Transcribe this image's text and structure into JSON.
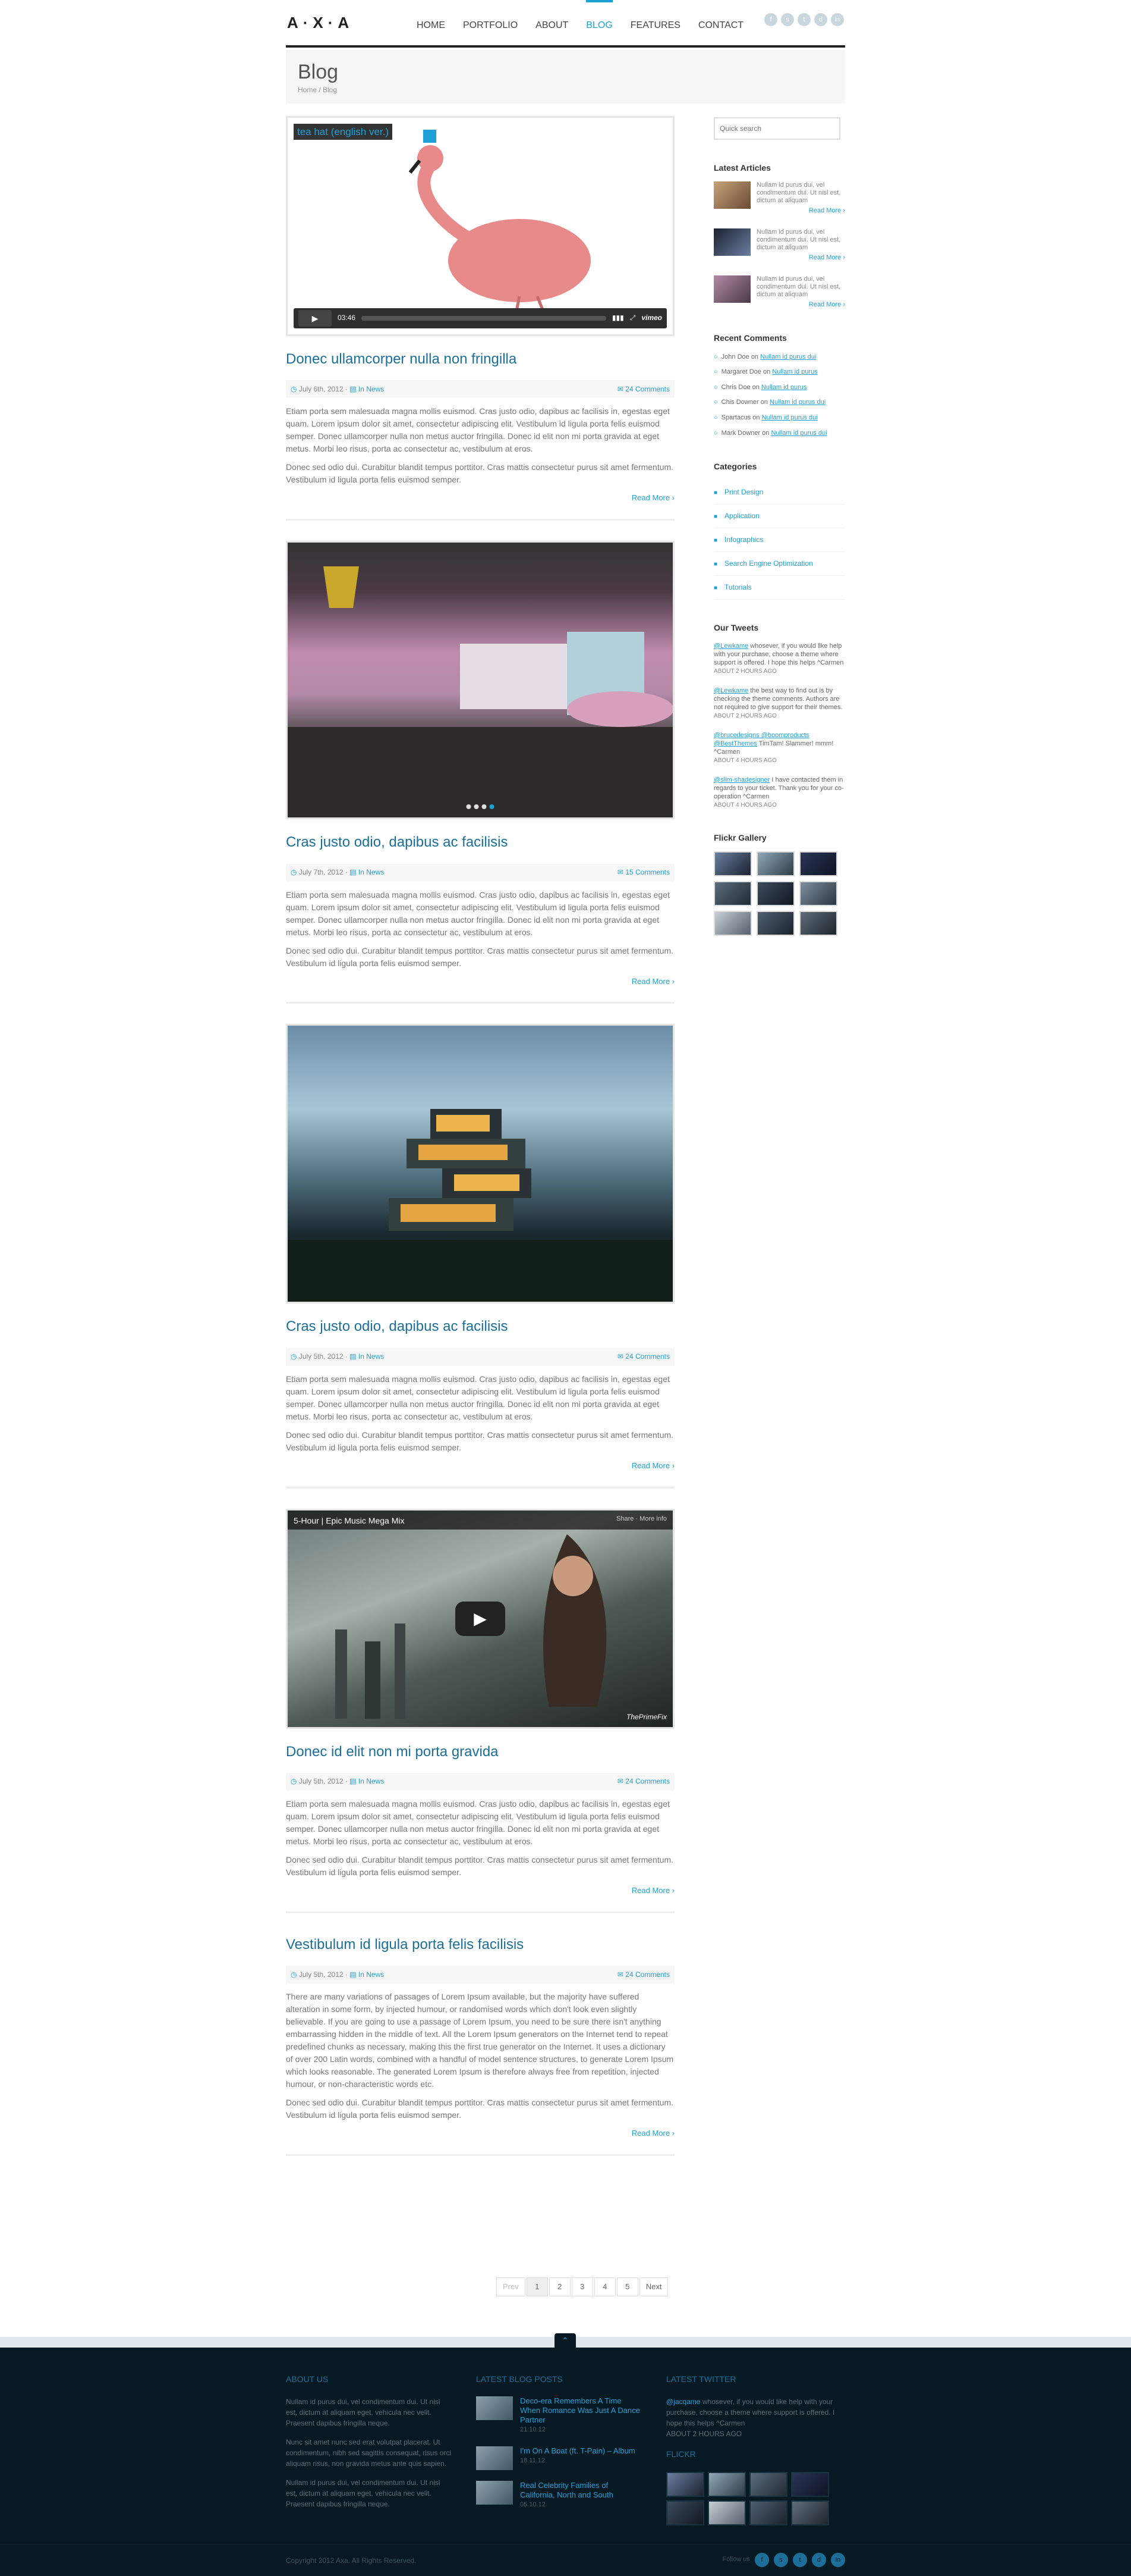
{
  "header": {
    "logo": "A·X·A",
    "nav": [
      "HOME",
      "PORTFOLIO",
      "ABOUT",
      "BLOG",
      "FEATURES",
      "CONTACT"
    ],
    "active_nav": "BLOG",
    "social": [
      "f",
      "s",
      "t",
      "d",
      "in"
    ]
  },
  "title_band": {
    "title": "Blog",
    "breadcrumb": "Home / Blog"
  },
  "posts": [
    {
      "media": {
        "type": "vimeo",
        "title": "tea hat (english ver.)",
        "time": "03:46",
        "brand": "vimeo"
      },
      "title": "Donec ullamcorper nulla non fringilla",
      "date": "July 6th, 2012",
      "category": "In News",
      "comments": "24 Comments",
      "paragraphs": [
        "Etiam porta sem malesuada magna mollis euismod. Cras justo odio, dapibus ac facilisis in, egestas eget quam. Lorem ipsum dolor sit amet, consectetur adipiscing elit. Vestibulum id ligula porta felis euismod semper. Donec ullamcorper nulla non metus auctor fringilla. Donec id elit non mi porta gravida at eget metus. Morbi leo risus, porta ac consectetur ac, vestibulum at eros.",
        "Donec sed odio dui. Curabitur blandit tempus porttitor. Cras mattis consectetur purus sit amet fermentum. Vestibulum id ligula porta felis euismod semper."
      ],
      "read_more": "Read More ›"
    },
    {
      "media": {
        "type": "slider"
      },
      "title": "Cras justo odio, dapibus ac facilisis",
      "date": "July 7th, 2012",
      "category": "In News",
      "comments": "15 Comments",
      "paragraphs": [
        "Etiam porta sem malesuada magna mollis euismod. Cras justo odio, dapibus ac facilisis in, egestas eget quam. Lorem ipsum dolor sit amet, consectetur adipiscing elit. Vestibulum id ligula porta felis euismod semper. Donec ullamcorper nulla non metus auctor fringilla. Donec id elit non mi porta gravida at eget metus. Morbi leo risus, porta ac consectetur ac, vestibulum at eros.",
        "Donec sed odio dui. Curabitur blandit tempus porttitor. Cras mattis consectetur purus sit amet fermentum. Vestibulum id ligula porta felis euismod semper."
      ],
      "read_more": "Read More ›"
    },
    {
      "media": {
        "type": "image"
      },
      "title": "Cras justo odio, dapibus ac facilisis",
      "date": "July 5th, 2012",
      "category": "In News",
      "comments": "24 Comments",
      "paragraphs": [
        "Etiam porta sem malesuada magna mollis euismod. Cras justo odio, dapibus ac facilisis in, egestas eget quam. Lorem ipsum dolor sit amet, consectetur adipiscing elit. Vestibulum id ligula porta felis euismod semper. Donec ullamcorper nulla non metus auctor fringilla. Donec id elit non mi porta gravida at eget metus. Morbi leo risus, porta ac consectetur ac, vestibulum at eros.",
        "Donec sed odio dui. Curabitur blandit tempus porttitor. Cras mattis consectetur purus sit amet fermentum. Vestibulum id ligula porta felis euismod semper."
      ],
      "read_more": "Read More ›"
    },
    {
      "media": {
        "type": "youtube",
        "title": "5-Hour | Epic Music Mega Mix",
        "actions": "Share  ·  More info",
        "brand": "ThePrimeFix"
      },
      "title": "Donec id elit non mi porta gravida",
      "date": "July 5th, 2012",
      "category": "In News",
      "comments": "24 Comments",
      "paragraphs": [
        "Etiam porta sem malesuada magna mollis euismod. Cras justo odio, dapibus ac facilisis in, egestas eget quam. Lorem ipsum dolor sit amet, consectetur adipiscing elit. Vestibulum id ligula porta felis euismod semper. Donec ullamcorper nulla non metus auctor fringilla. Donec id elit non mi porta gravida at eget metus. Morbi leo risus, porta ac consectetur ac, vestibulum at eros.",
        "Donec sed odio dui. Curabitur blandit tempus porttitor. Cras mattis consectetur purus sit amet fermentum. Vestibulum id ligula porta felis euismod semper."
      ],
      "read_more": "Read More ›"
    },
    {
      "media": {
        "type": "none"
      },
      "title": "Vestibulum id ligula porta felis facilisis",
      "date": "July 5th, 2012",
      "category": "In News",
      "comments": "24 Comments",
      "paragraphs": [
        "There are many variations of passages of Lorem Ipsum available, but the majority have suffered alteration in some form, by injected humour, or randomised words which don't look even slightly believable. If you are going to use a passage of Lorem Ipsum, you need to be sure there isn't anything embarrassing hidden in the middle of text. All the Lorem Ipsum generators on the Internet tend to repeat predefined chunks as necessary, making this the first true generator on the Internet. It uses a dictionary of over 200 Latin words, combined with a handful of model sentence structures, to generate Lorem Ipsum which looks reasonable. The generated Lorem Ipsum is therefore always free from repetition, injected humour, or non-characteristic words etc.",
        "Donec sed odio dui. Curabitur blandit tempus porttitor. Cras mattis consectetur purus sit amet fermentum. Vestibulum id ligula porta felis euismod semper."
      ],
      "read_more": "Read More ›"
    }
  ],
  "pagination": [
    "Prev",
    "1",
    "2",
    "3",
    "4",
    "5",
    "Next"
  ],
  "sidebar": {
    "search_placeholder": "Quick search",
    "latest_title": "Latest Articles",
    "latest": [
      {
        "text": "Nullam id purus dui, vel condimentum dui. Ut nisl est, dictum at aliquam",
        "more": "Read More ›"
      },
      {
        "text": "Nullam id purus dui, vel condimentum dui. Ut nisl est, dictum at aliquam",
        "more": "Read More ›"
      },
      {
        "text": "Nullam id purus dui, vel condimentum dui. Ut nisl est, dictum at aliquam",
        "more": "Read More ›"
      }
    ],
    "comments_title": "Recent Comments",
    "comments": [
      {
        "author": "John Doe",
        "on": "on",
        "link": "Nullam id purus dui"
      },
      {
        "author": "Margaret Doe",
        "on": "on",
        "link": "Nullam id purus"
      },
      {
        "author": "Chris Doe",
        "on": "on",
        "link": "Nullam id purus"
      },
      {
        "author": "Chis Downer",
        "on": "on",
        "link": "Nullam id purus dui"
      },
      {
        "author": "Spartacus",
        "on": "on",
        "link": "Nullam id purus dui"
      },
      {
        "author": "Mark Downer",
        "on": "on",
        "link": "Nullam id purus dui"
      }
    ],
    "categories_title": "Categories",
    "categories": [
      "Print Design",
      "Application",
      "Infographics",
      "Search Engine Optimization",
      "Tutorials"
    ],
    "tweets_title": "Our Tweets",
    "tweets": [
      {
        "handle": "@Lewkame",
        "text": " whosever, if you would like help with your purchase, choose a theme where support is offered. I hope this helps ^Carmen",
        "ago": "ABOUT 2 HOURS AGO"
      },
      {
        "handle": "@Lewkame",
        "text": " the best way to find out is by checking the theme comments. Authors are not required to give support for their themes.",
        "ago": "ABOUT 2 HOURS AGO"
      },
      {
        "handle": "@brucedesigns @boomproducts @BestThemes",
        "text": " TimTam! Slammer! mmm! ^Carmen",
        "ago": "ABOUT 4 HOURS AGO"
      },
      {
        "handle": "@slim-shadesigner",
        "text": " I have contacted them in regards to your ticket. Thank you for your co-operation ^Carmen",
        "ago": "ABOUT 4 HOURS AGO"
      }
    ],
    "flickr_title": "Flickr Gallery"
  },
  "footer": {
    "about_title": "About Us",
    "about_paragraphs": [
      "Nullam id purus dui, vel condimentum dui. Ut nisl est, dictum at aliquam eget, vehicula nec velit. Praesent dapibus fringilla neque.",
      "Nunc sit amet nunc sed erat volutpat placerat. Ut condimentum, nibh sed sagittis consequat, risus orci aliquam risus, non gravida metus ante quis sapien.",
      "Nullam id purus dui, vel condimentum dui. Ut nisl est, dictum at aliquam eget, vehicula nec velit. Praesent dapibus fringilla neque."
    ],
    "blog_title": "Latest Blog Posts",
    "blog_posts": [
      {
        "title": "Deco-era Remembers A Time When Romance Was Just A Dance Partner",
        "date": "21.10.12"
      },
      {
        "title": "I'm On A Boat (ft. T-Pain) – Album",
        "date": "18.11.12"
      },
      {
        "title": "Real Celebrity Families of California, North and South",
        "date": "05.10.12"
      }
    ],
    "twitter_title": "Latest Twitter",
    "tweet_handle": "@jacqame",
    "tweet_text": " whosever, if you would like help with your purchase, choose a theme where support is offered. I hope this helps ^Carmen",
    "tweet_ago": "ABOUT 2 HOURS AGO",
    "flickr_title": "Flickr",
    "copyright": "Copyright 2012 Axa. All Rights Reserved.",
    "follow": "Follow us",
    "social": [
      "f",
      "s",
      "t",
      "d",
      "in"
    ]
  }
}
